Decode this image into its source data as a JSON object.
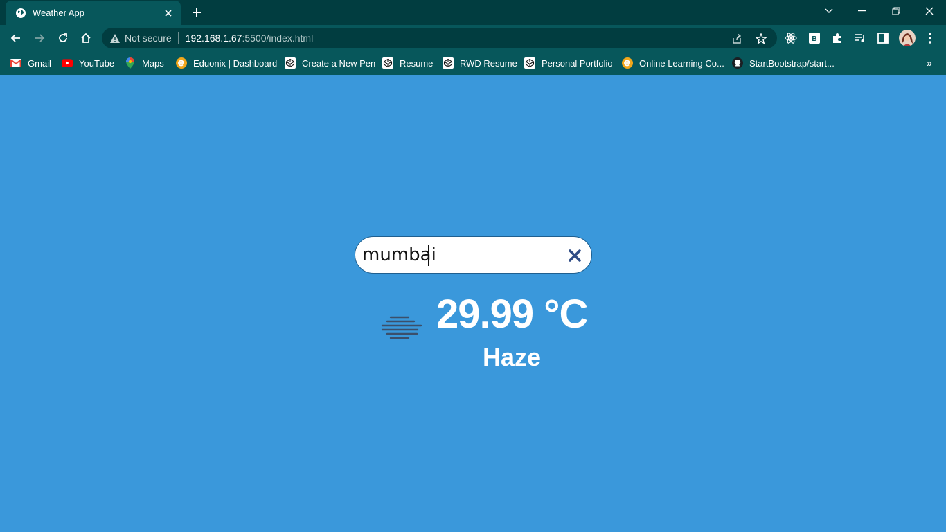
{
  "browser": {
    "tab": {
      "title": "Weather App",
      "favicon": "globe-icon"
    },
    "security_label": "Not secure",
    "url_host": "192.168.1.67",
    "url_rest": ":5500/index.html"
  },
  "bookmarks": [
    {
      "label": "Gmail",
      "icon": "gmail-icon"
    },
    {
      "label": "YouTube",
      "icon": "youtube-icon"
    },
    {
      "label": "Maps",
      "icon": "maps-icon"
    },
    {
      "label": "Eduonix | Dashboard",
      "icon": "eduonix-icon"
    },
    {
      "label": "Create a New Pen",
      "icon": "codepen-icon"
    },
    {
      "label": "Resume",
      "icon": "codepen-icon"
    },
    {
      "label": "RWD Resume",
      "icon": "codepen-icon"
    },
    {
      "label": "Personal Portfolio",
      "icon": "codepen-icon"
    },
    {
      "label": "Online Learning Co...",
      "icon": "eduonix-icon"
    },
    {
      "label": "StartBootstrap/start...",
      "icon": "github-icon"
    }
  ],
  "bookmarks_more": "»",
  "weather": {
    "search_value": "mumbai",
    "temperature": "29.99 °C",
    "description": "Haze",
    "icon": "haze-icon"
  },
  "colors": {
    "page_background": "#3a98db",
    "browser_frame": "#07575b",
    "tab_strip": "#013d40"
  }
}
